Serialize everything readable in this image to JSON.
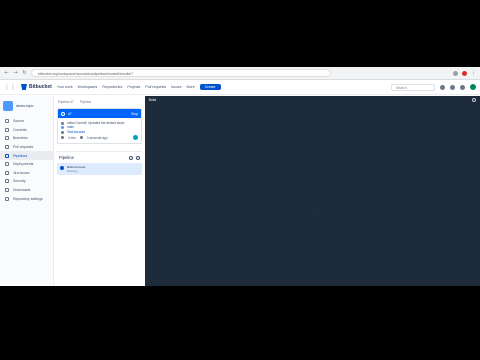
{
  "browser": {
    "url": "bitbucket.org/workspace/repo/addon/pipelines/home#!/results/7"
  },
  "topbar": {
    "product": "Bitbucket",
    "menu": [
      "Your work",
      "Workspaces",
      "Repositories",
      "Projects",
      "Pull requests",
      "Issues",
      "More"
    ],
    "create_label": "Create",
    "search_placeholder": "Search"
  },
  "sidebar": {
    "workspace_name": "demo-repo",
    "items": [
      {
        "label": "Source",
        "icon": "source-icon",
        "active": false
      },
      {
        "label": "Commits",
        "icon": "commits-icon",
        "active": false
      },
      {
        "label": "Branches",
        "icon": "branches-icon",
        "active": false
      },
      {
        "label": "Pull requests",
        "icon": "pull-requests-icon",
        "active": false
      },
      {
        "label": "Pipelines",
        "icon": "pipelines-icon",
        "active": true
      },
      {
        "label": "Deployments",
        "icon": "deployments-icon",
        "active": false
      },
      {
        "label": "Jira issues",
        "icon": "jira-icon",
        "active": false
      },
      {
        "label": "Security",
        "icon": "security-icon",
        "active": false
      },
      {
        "label": "Downloads",
        "icon": "downloads-icon",
        "active": false
      },
      {
        "label": "Repository settings",
        "icon": "settings-icon",
        "active": false
      }
    ]
  },
  "breadcrumb": {
    "first": "Pipeline #7",
    "second": "Pipeline"
  },
  "run": {
    "title": "#7",
    "action": "Stop",
    "commit_message": "Initial Commit: Updated the default steps",
    "branch": "main",
    "author": "Test Account",
    "duration": "4 min",
    "time": "3 seconds ago"
  },
  "pipeline_panel": {
    "heading": "Pipeline",
    "step_title": "Build and test",
    "step_subtitle": "Running"
  },
  "log": {
    "title": "Build",
    "cursor": "_"
  }
}
